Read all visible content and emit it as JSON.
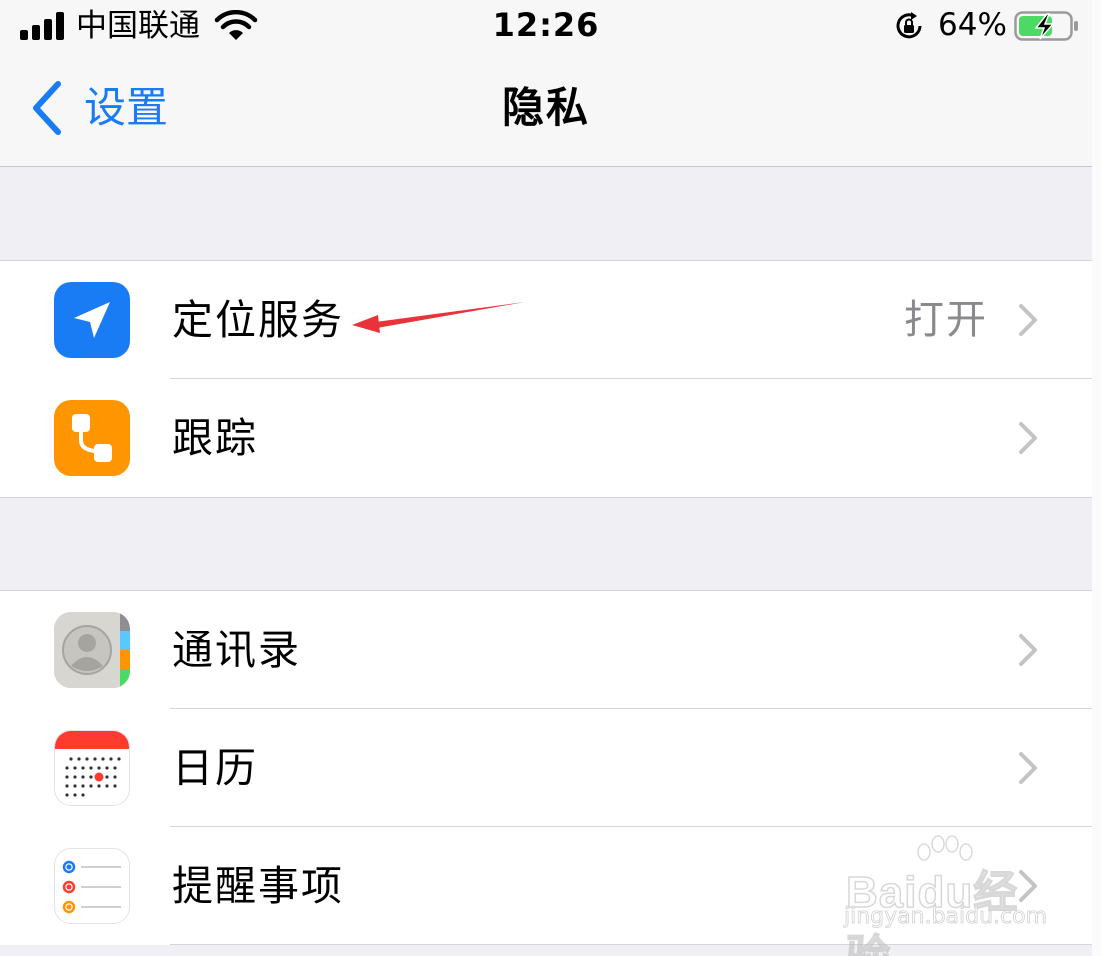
{
  "status_bar": {
    "carrier": "中国联通",
    "time": "12:26",
    "battery_percent": "64%",
    "signal_bars": 4,
    "charging": true
  },
  "nav": {
    "back_label": "设置",
    "title": "隐私"
  },
  "sections": [
    {
      "rows": [
        {
          "label": "定位服务",
          "value": "打开",
          "icon": "location-arrow-icon",
          "icon_color": "#1a7cf5"
        },
        {
          "label": "跟踪",
          "value": "",
          "icon": "tracking-icon",
          "icon_color": "#ff9500"
        }
      ]
    },
    {
      "rows": [
        {
          "label": "通讯录",
          "value": "",
          "icon": "contacts-icon",
          "icon_color": "#d8d6d0"
        },
        {
          "label": "日历",
          "value": "",
          "icon": "calendar-icon",
          "icon_color": "#ffffff"
        },
        {
          "label": "提醒事项",
          "value": "",
          "icon": "reminders-icon",
          "icon_color": "#ffffff"
        }
      ]
    }
  ],
  "annotation": {
    "type": "red-arrow",
    "color": "#e8333a"
  },
  "watermark": {
    "brand": "Baidu经验",
    "url": "jingyan.baidu.com"
  },
  "colors": {
    "accent": "#1a7cf5",
    "secondary_text": "#8a8a8e",
    "background": "#efeff4"
  }
}
